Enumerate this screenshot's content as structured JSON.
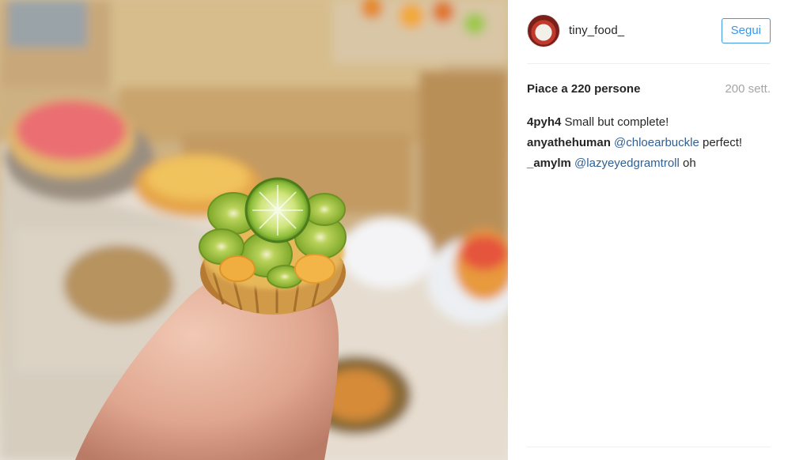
{
  "post": {
    "image_icon": "miniature-fruit-tart-photo",
    "username": "tiny_food_",
    "follow_label": "Segui",
    "likes_label": "Piace a 220 persone",
    "time_label": "200 sett."
  },
  "comments": [
    {
      "user": "4pyh4",
      "mention": "",
      "text": "Small but complete!"
    },
    {
      "user": "anyathehuman",
      "mention": "@chloearbuckle",
      "text": "perfect!"
    },
    {
      "user": "_amylm",
      "mention": "@lazyeyedgramtroll",
      "text": "oh"
    }
  ],
  "colors": {
    "follow_border": "#3f9ae3",
    "follow_text": "#3897f0",
    "mention": "#2f5f93",
    "meta_gray": "#a5a5a5"
  }
}
